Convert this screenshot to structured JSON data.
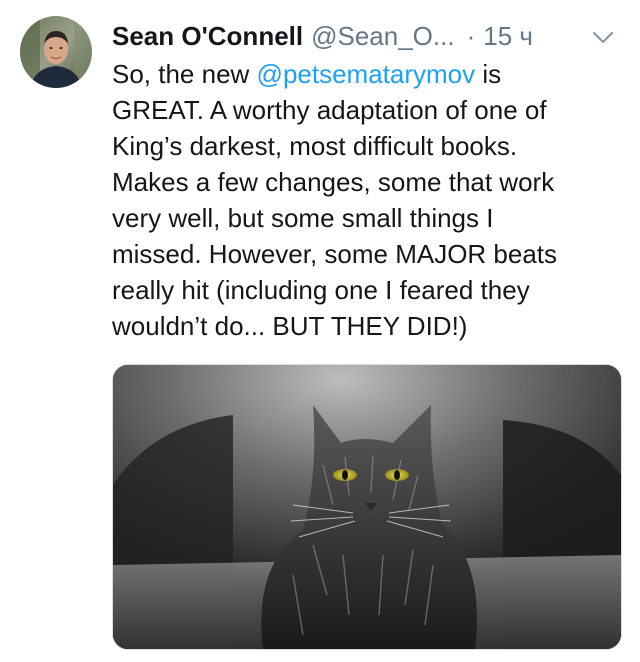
{
  "tweet": {
    "author_name": "Sean O'Connell",
    "author_handle": "@Sean_O...",
    "separator": "·",
    "time": "15 ч",
    "text_lines": [
      {
        "prefix": "So, the new ",
        "mention": "@petsematarymov",
        "suffix": " is"
      },
      "GREAT. A worthy adaptation of one of",
      "King’s darkest, most difficult books.",
      "Makes a few changes, some that work",
      "very well, but some small things I",
      "missed. However, some MAJOR beats",
      "really hit (including one I feared they",
      "wouldn’t do... BUT THEY DID!)"
    ],
    "icons": {
      "more": "chevron-down-icon",
      "avatar": "profile-photo"
    },
    "colors": {
      "mention": "#1da1f2",
      "secondary": "#657786",
      "text": "#14171a"
    }
  }
}
